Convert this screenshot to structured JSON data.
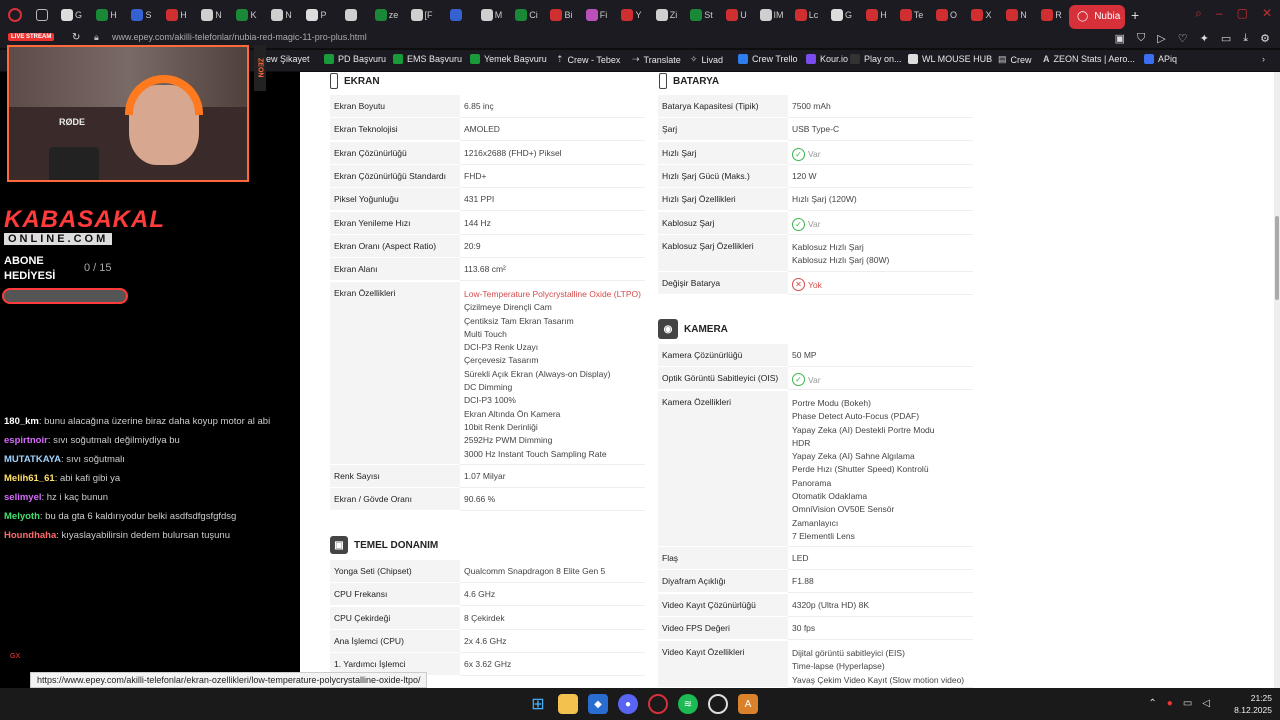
{
  "browser": {
    "active_tab_title": "Nubia",
    "url": "www.epey.com/akilli-telefonlar/nubia-red-magic-11-pro-plus.html",
    "status_url": "https://www.epey.com/akilli-telefonlar/ekran-ozellikleri/low-temperature-polycrystalline-oxide-ltpo/",
    "mini_tabs": [
      "G",
      "H",
      "S",
      "H",
      "N",
      "K",
      "N",
      "P",
      "",
      "ze",
      "[F",
      "",
      "M",
      "Ci",
      "Bi",
      "Fi",
      "Y",
      "Zi",
      "St",
      "U",
      "IM",
      "Lc",
      "G",
      "H",
      "Te",
      "O",
      "X",
      "N",
      "R"
    ],
    "bookmarks": [
      "PD Başvuru",
      "EMS Başvuru",
      "Yemek Başvuru",
      "Crew - Tebex",
      "Translate",
      "Livad",
      "Crew Trello",
      "Kour.io",
      "Play on...",
      "WL MOUSE HUB",
      "Crew",
      "ZEON Stats | Aero...",
      "APiq"
    ],
    "bookmark_prefix": "ew Şikayet"
  },
  "sections": {
    "ekran": {
      "title": "EKRAN",
      "rows": [
        {
          "label": "Ekran Boyutu",
          "value": "6.85 inç"
        },
        {
          "label": "Ekran Teknolojisi",
          "value": "AMOLED"
        },
        {
          "label": "Ekran Çözünürlüğü",
          "value": "1216x2688 (FHD+) Piksel"
        },
        {
          "label": "Ekran Çözünürlüğü Standardı",
          "value": "FHD+"
        },
        {
          "label": "Piksel Yoğunluğu",
          "value": "431 PPI"
        },
        {
          "label": "Ekran Yenileme Hızı",
          "value": "144 Hz"
        },
        {
          "label": "Ekran Oranı (Aspect Ratio)",
          "value": "20:9"
        },
        {
          "label": "Ekran Alanı",
          "value": "113.68 cm²"
        }
      ],
      "features_label": "Ekran Özellikleri",
      "features": [
        "Low-Temperature Polycrystalline Oxide (LTPO)",
        "Çizilmeye Dirençli Cam",
        "Çentiksiz Tam Ekran Tasarım",
        "Multi Touch",
        "DCI-P3 Renk Uzayı",
        "Çerçevesiz Tasarım",
        "Sürekli Açık Ekran (Always-on Display)",
        "DC Dimming",
        "DCI-P3 100%",
        "Ekran Altında Ön Kamera",
        "10bit Renk Derinliği",
        "2592Hz PWM Dimming",
        "3000 Hz Instant Touch Sampling Rate"
      ],
      "rows2": [
        {
          "label": "Renk Sayısı",
          "value": "1.07 Milyar"
        },
        {
          "label": "Ekran / Gövde Oranı",
          "value": "90.66 %"
        }
      ]
    },
    "temel": {
      "title": "TEMEL DONANIM",
      "rows": [
        {
          "label": "Yonga Seti (Chipset)",
          "value": "Qualcomm Snapdragon 8 Elite Gen 5"
        },
        {
          "label": "CPU Frekansı",
          "value": "4.6 GHz"
        },
        {
          "label": "CPU Çekirdeği",
          "value": "8 Çekirdek"
        },
        {
          "label": "Ana İşlemci (CPU)",
          "value": "2x 4.6 GHz"
        },
        {
          "label": "1. Yardımcı İşlemci",
          "value": "6x 3.62 GHz"
        }
      ]
    },
    "batarya": {
      "title": "BATARYA",
      "rows": [
        {
          "label": "Batarya Kapasitesi (Tipik)",
          "value": "7500 mAh",
          "kind": "text"
        },
        {
          "label": "Şarj",
          "value": "USB Type-C",
          "kind": "text"
        },
        {
          "label": "Hızlı Şarj",
          "value": "Var",
          "kind": "ok"
        },
        {
          "label": "Hızlı Şarj Gücü (Maks.)",
          "value": "120 W",
          "kind": "text"
        },
        {
          "label": "Hızlı Şarj Özellikleri",
          "value": "Hızlı Şarj (120W)",
          "kind": "text"
        },
        {
          "label": "Kablosuz Şarj",
          "value": "Var",
          "kind": "ok"
        }
      ],
      "wireless_label": "Kablosuz Şarj Özellikleri",
      "wireless_lines": [
        "Kablosuz Hızlı Şarj",
        "Kablosuz Hızlı Şarj (80W)"
      ],
      "swap_label": "Değişir Batarya",
      "swap_value": "Yok"
    },
    "kamera": {
      "title": "KAMERA",
      "res_label": "Kamera Çözünürlüğü",
      "res_value": "50 MP",
      "ois_label": "Optik Görüntü Sabitleyici (OIS)",
      "ois_value": "Var",
      "features_label": "Kamera Özellikleri",
      "features": [
        "Portre Modu (Bokeh)",
        "Phase Detect Auto-Focus (PDAF)",
        "Yapay Zeka (AI) Destekli Portre Modu",
        "HDR",
        "Yapay Zeka (AI) Sahne Algılama",
        "Perde Hızı (Shutter Speed) Kontrolü",
        "Panorama",
        "Otomatik Odaklama",
        "OmniVision OV50E Sensör",
        "Zamanlayıcı",
        "7 Elementli Lens"
      ],
      "rows2": [
        {
          "label": "Flaş",
          "value": "LED"
        },
        {
          "label": "Diyafram Açıklığı",
          "value": "F1.88"
        },
        {
          "label": "Video Kayıt Çözünürlüğü",
          "value": "4320p (Ultra HD) 8K"
        },
        {
          "label": "Video FPS Değeri",
          "value": "30 fps"
        }
      ],
      "video_label": "Video Kayıt Özellikleri",
      "video_lines": [
        "Dijital görüntü sabitleyici (EIS)",
        "Time-lapse (Hyperlapse)",
        "Yavaş Çekim Video Kayıt (Slow motion video)"
      ]
    }
  },
  "stream": {
    "live_badge": "LIVE STREAM",
    "zeon_tag": "ZEON",
    "rode": "RØDE",
    "brand": "KABASAKAL",
    "brand_sub": "ONLINE.COM",
    "abone_line1": "ABONE",
    "abone_line2": "HEDİYESİ",
    "abone_count": "0 / 15",
    "chat": [
      {
        "user": "180_km",
        "text": ": bunu alacağına üzerine biraz daha koyup motor al abi",
        "color": "#ffffff"
      },
      {
        "user": "espirtnoir",
        "text": ": sıvı soğutmalı değilmiydiya bu",
        "color": "#d66bff"
      },
      {
        "user": "MUTATKAYA",
        "text": ": sıvı soğutmalı",
        "color": "#9fd4ff"
      },
      {
        "user": "Melih61_61",
        "text": ": abi kafi gibi ya",
        "color": "#ffe066"
      },
      {
        "user": "selimyel",
        "text": ": hz i kaç bunun",
        "color": "#d66bff"
      },
      {
        "user": "Melyoth",
        "text": ": bu da gta 6 kaldırıyodur belki asdfsdfgsfgfdsg",
        "color": "#40e070"
      },
      {
        "user": "Houndhaha",
        "text": ": kıyaslayabilirsin dedem bulursan tuşunu",
        "color": "#ff6b6b"
      }
    ]
  },
  "taskbar": {
    "time": "21:25",
    "date": "8.12.2025"
  }
}
